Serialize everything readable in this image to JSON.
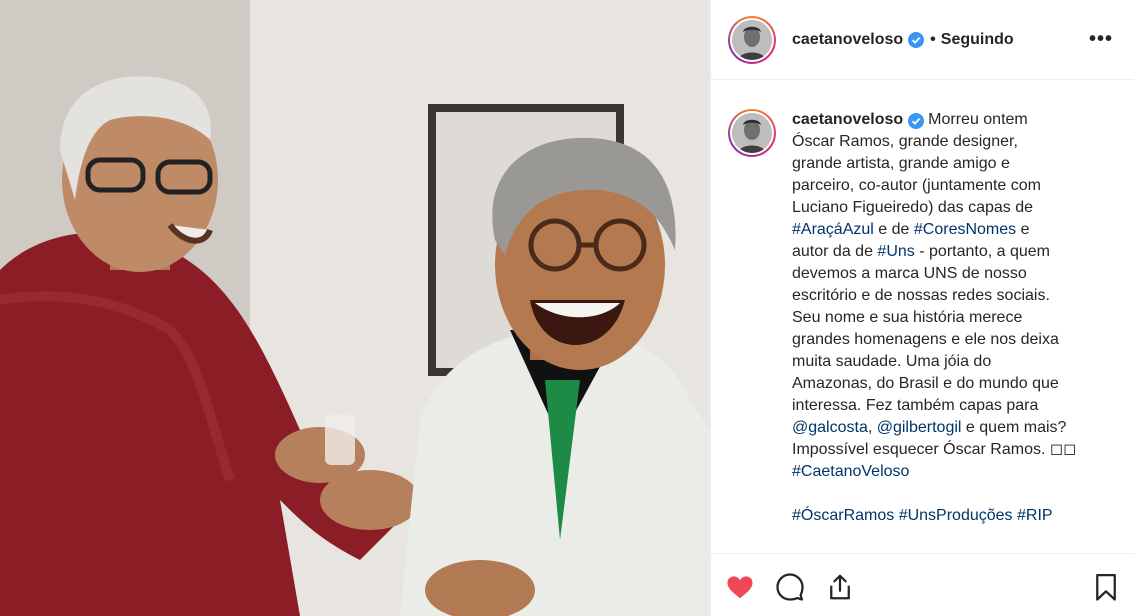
{
  "header": {
    "username": "caetanoveloso",
    "separator": "•",
    "follow_status": "Seguindo",
    "more_label": "•••"
  },
  "caption": {
    "username": "caetanoveloso",
    "lines": [
      "Morreu ontem",
      "Óscar Ramos, grande designer,",
      "grande artista, grande amigo e",
      "parceiro, co-autor (juntamente com",
      "Luciano Figueiredo) das capas de",
      "#AraçáAzul e de #CoresNomes e",
      "autor da de #Uns - portanto, a quem",
      "devemos a marca UNS de nosso",
      "escritório e de nossas redes sociais.",
      "Seu nome e sua história merece",
      "grandes homenagens e ele nos deixa",
      "muita saudade. Uma jóia do",
      "Amazonas, do Brasil e do mundo que",
      "interessa. Fez também capas para",
      "@galcosta, @gilbertogil e quem mais?",
      "Impossível esquecer Óscar Ramos. ◻◻",
      "#CaetanoVeloso"
    ],
    "tags_line": "#ÓscarRamos #UnsProduções #RIP"
  },
  "colors": {
    "verified": "#3897f0",
    "link": "#003569",
    "like": "#ed4956",
    "border": "#efefef"
  },
  "actions": {
    "like_icon": "heart-filled-icon",
    "comment_icon": "comment-icon",
    "share_icon": "share-icon",
    "save_icon": "bookmark-icon"
  }
}
